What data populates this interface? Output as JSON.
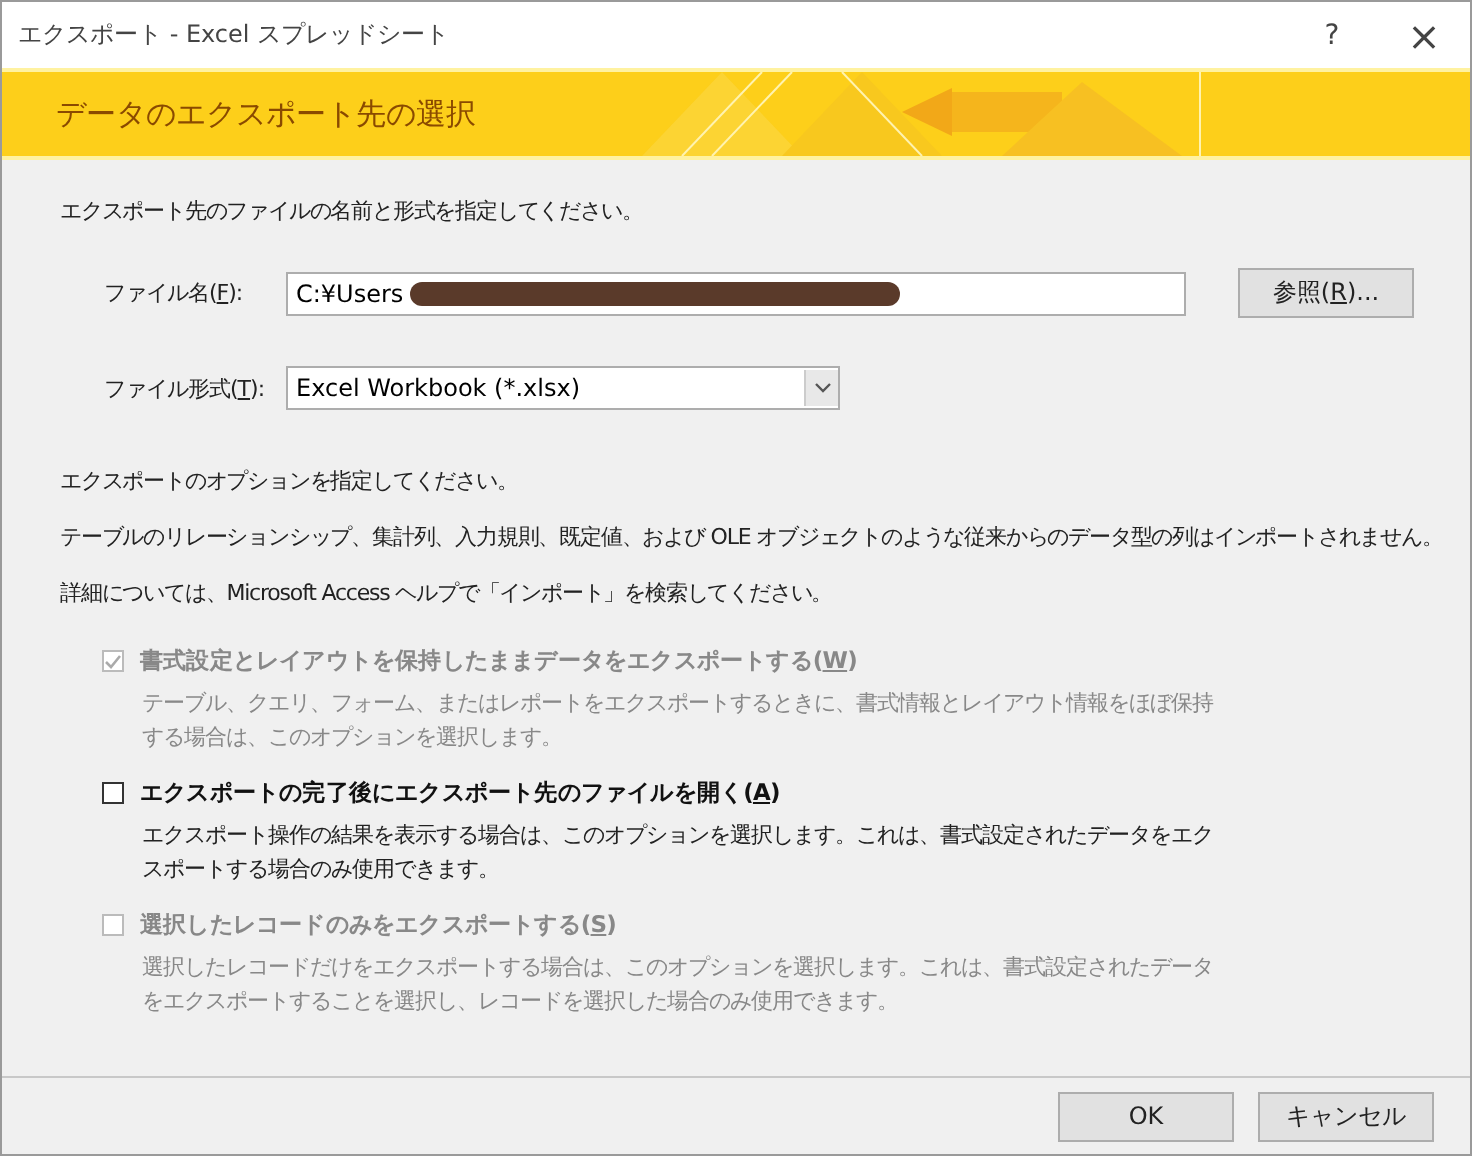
{
  "window": {
    "title": "エクスポート - Excel スプレッドシート",
    "help": "?",
    "close": "×"
  },
  "header": {
    "title": "データのエクスポート先の選択"
  },
  "instruction": "エクスポート先のファイルの名前と形式を指定してください。",
  "file_name": {
    "label_before": "ファイル名(",
    "mnemonic": "F",
    "label_after": "):",
    "value": "C:¥Users",
    "redacted": true
  },
  "browse_button": {
    "label_before": "参照(",
    "mnemonic": "R",
    "label_after": ")..."
  },
  "file_format": {
    "label_before": "ファイル形式(",
    "mnemonic": "T",
    "label_after": "):",
    "value": "Excel Workbook (*.xlsx)"
  },
  "notes": [
    "エクスポートのオプションを指定してください。",
    "テーブルのリレーションシップ、集計列、入力規則、既定値、および OLE オブジェクトのような従来からのデータ型の列はインポートされません。",
    "詳細については、Microsoft Access ヘルプで「インポート」を検索してください。"
  ],
  "options": [
    {
      "kind": "checkbox",
      "label_before": "書式設定とレイアウトを保持したままデータをエクスポートする(",
      "mnemonic": "W",
      "label_after": ")",
      "checked": true,
      "disabled": true,
      "description": "テーブル、クエリ、フォーム、またはレポートをエクスポートするときに、書式情報とレイアウト情報をほぼ保持する場合は、このオプションを選択します。"
    },
    {
      "kind": "checkbox",
      "label_before": "エクスポートの完了後にエクスポート先のファイルを開く(",
      "mnemonic": "A",
      "label_after": ")",
      "checked": false,
      "disabled": false,
      "description": "エクスポート操作の結果を表示する場合は、このオプションを選択します。これは、書式設定されたデータをエクスポートする場合のみ使用できます。"
    },
    {
      "kind": "checkbox",
      "label_before": "選択したレコードのみをエクスポートする(",
      "mnemonic": "S",
      "label_after": ")",
      "checked": false,
      "disabled": true,
      "description": "選択したレコードだけをエクスポートする場合は、このオプションを選択します。これは、書式設定されたデータをエクスポートすることを選択し、レコードを選択した場合のみ使用できます。"
    }
  ],
  "buttons": [
    "OK",
    "キャンセル"
  ]
}
